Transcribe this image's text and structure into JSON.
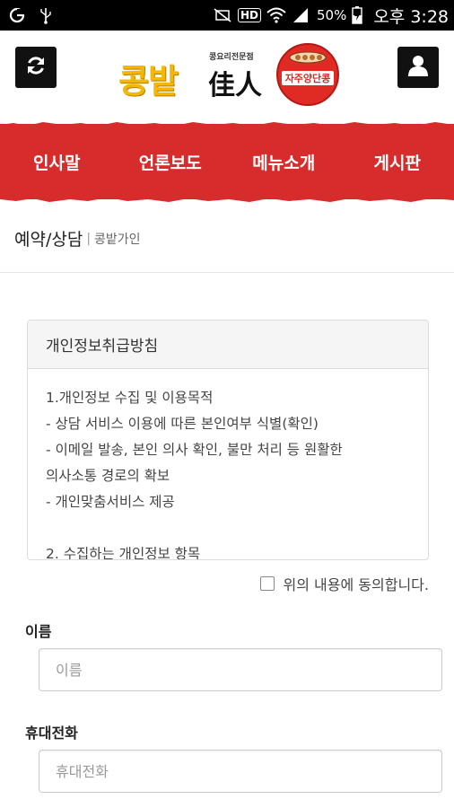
{
  "status_bar": {
    "battery_percent": "50%",
    "time": "오후 3:28",
    "hd_label": "HD"
  },
  "header": {
    "logo": {
      "main": "콩밭",
      "subtitle": "콩요리전문점",
      "hanja": "佳人",
      "badge_text": "자주양단콩"
    },
    "left_icon": "refresh-icon",
    "right_icon": "user-icon"
  },
  "nav": {
    "accent": "#d72c2c",
    "items": [
      {
        "label": "인사말"
      },
      {
        "label": "언론보도"
      },
      {
        "label": "메뉴소개"
      },
      {
        "label": "게시판"
      }
    ]
  },
  "breadcrumb": {
    "title": "예약/상담",
    "separator": "|",
    "sub": "콩밭가인"
  },
  "privacy": {
    "heading": "개인정보취급방침",
    "lines": [
      "1.개인정보 수집 및 이용목적",
      "- 상담 서비스 이용에 따른 본인여부 식별(확인)",
      "- 이메일 발송, 본인 의사 확인, 불만 처리 등 원활한",
      "의사소통 경로의 확보",
      "- 개인맞춤서비스 제공",
      "",
      "2. 수집하는 개인정보 항목"
    ],
    "agree_label": "위의 내용에 동의합니다.",
    "agree_checked": false
  },
  "form": {
    "name": {
      "label": "이름",
      "placeholder": "이름",
      "value": ""
    },
    "phone": {
      "label": "휴대전화",
      "placeholder": "휴대전화",
      "value": ""
    }
  }
}
